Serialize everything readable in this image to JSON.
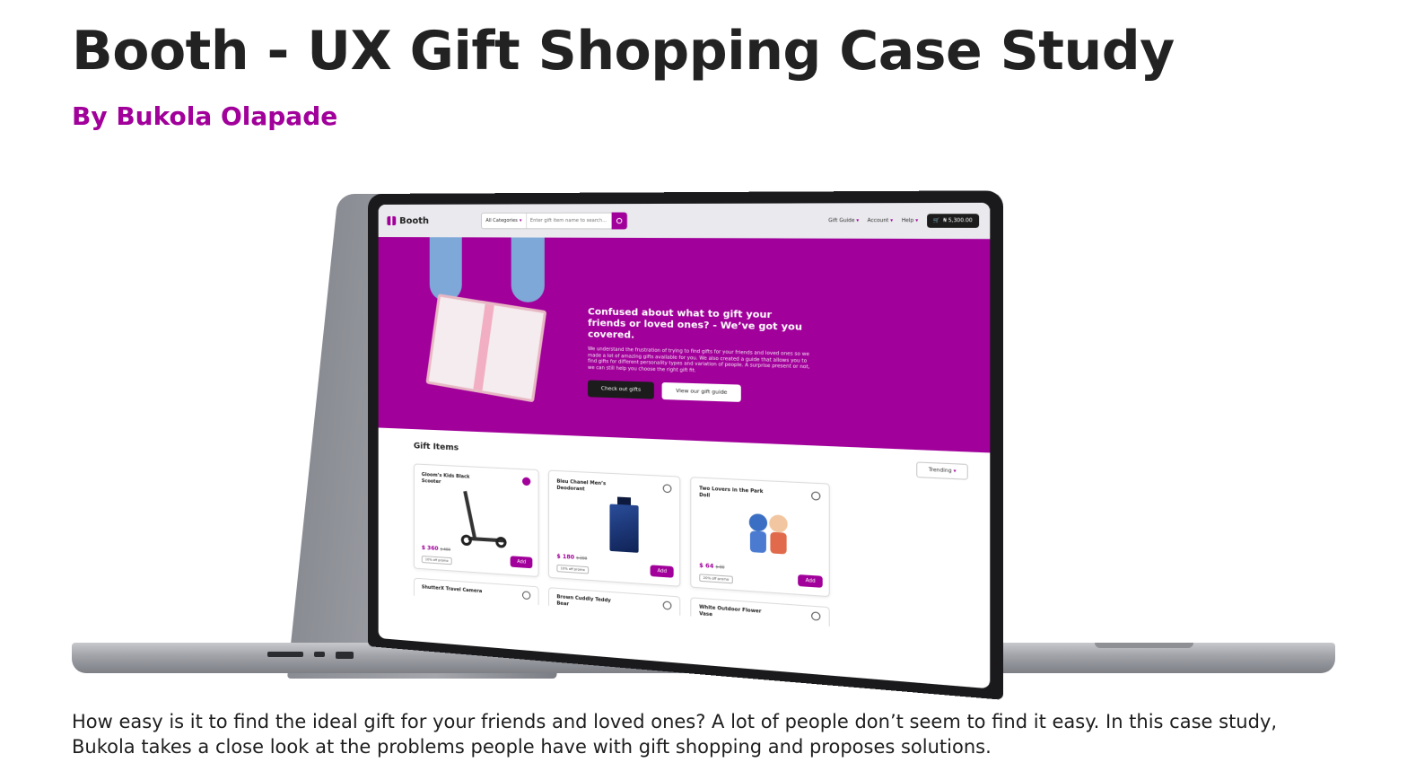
{
  "title": "Booth - UX Gift Shopping Case Study",
  "byline": "By Bukola Olapade",
  "description": "How easy is it to find the ideal gift for your friends and loved ones? A lot of people don’t seem to find it easy. In this case study, Bukola takes a close look at the problems people have with gift shopping and proposes solutions.",
  "colors": {
    "accent": "#a1009a",
    "text": "#222222"
  },
  "site": {
    "logo": "Booth",
    "search": {
      "category": "All Categories",
      "placeholder": "Enter gift item name to search..."
    },
    "nav": [
      "Gift Guide",
      "Account",
      "Help"
    ],
    "cart": "₦ 5,300.00",
    "hero": {
      "headline": "Confused about what to gift your friends or loved ones? - We’ve got you covered.",
      "body": "We understand the frustration of trying to find gifts for your friends and loved ones so we made a lot of amazing gifts available for you. We also created a guide that allows you to find gifts for different personality types and variation of people. A surprise present or not, we can still help you choose the right gift fit.",
      "primary_cta": "Check out gifts",
      "secondary_cta": "View our gift guide"
    },
    "gifts_title": "Gift Items",
    "sort": "Trending",
    "products": [
      {
        "name": "Gloom’s Kids Black Scooter",
        "price": "$ 360",
        "old_price": "$ 400",
        "promo": "10% off promo",
        "add": "Add",
        "favorited": true
      },
      {
        "name": "Bleu Chanel Men’s Deodorant",
        "price": "$ 180",
        "old_price": "$ 200",
        "promo": "10% off promo",
        "add": "Add",
        "favorited": false
      },
      {
        "name": "Two Lovers in the Park Doll",
        "price": "$ 64",
        "old_price": "$ 80",
        "promo": "20% off promo",
        "add": "Add",
        "favorited": false
      }
    ],
    "products_row2": [
      {
        "name": "ShutterX Travel Camera"
      },
      {
        "name": "Brown Cuddly Teddy Bear"
      },
      {
        "name": "White Outdoor Flower Vase"
      }
    ]
  }
}
